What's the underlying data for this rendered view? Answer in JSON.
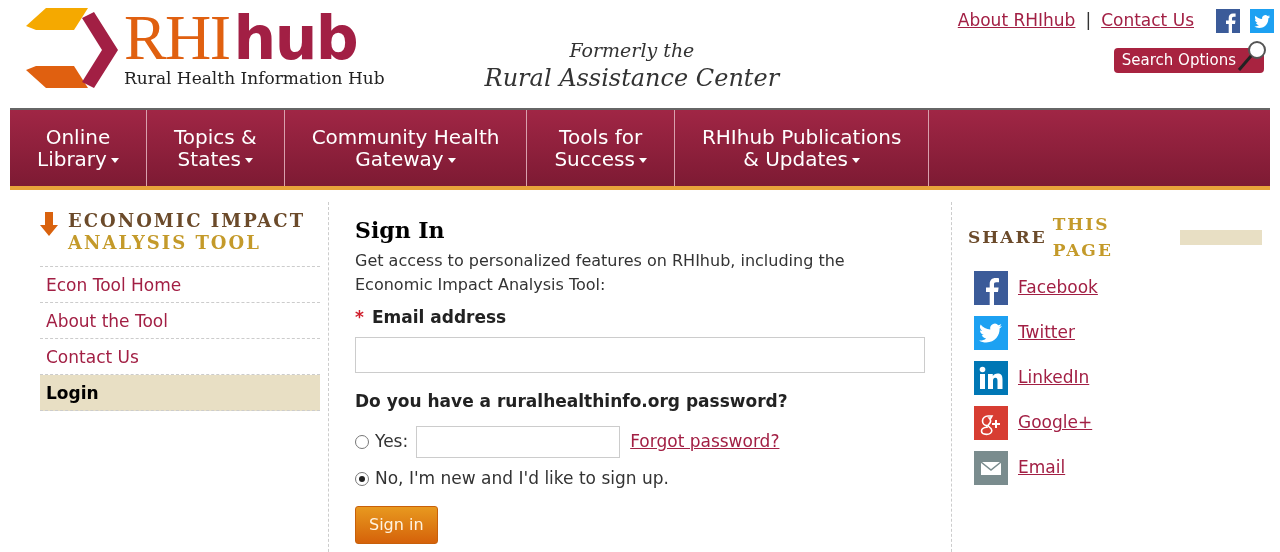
{
  "header": {
    "logo": {
      "brand_main": "RHI",
      "brand_accent": "hub",
      "subtitle": "Rural Health Information Hub"
    },
    "tagline": {
      "line_1": "Formerly the",
      "line_2": "Rural Assistance Center"
    },
    "top_links": [
      "About RHIhub",
      "Contact Us"
    ],
    "separator": "|",
    "search_button": "Search Options"
  },
  "nav": [
    {
      "line_1": "Online",
      "line_2": "Library"
    },
    {
      "line_1": "Topics &",
      "line_2": "States"
    },
    {
      "line_1": "Community Health",
      "line_2": "Gateway"
    },
    {
      "line_1": "Tools for",
      "line_2": "Success"
    },
    {
      "line_1": "RHIhub Publications",
      "line_2": "& Updates"
    }
  ],
  "sidebar": {
    "heading_1": "ECONOMIC IMPACT",
    "heading_2": "ANALYSIS TOOL",
    "items": [
      {
        "label": "Econ Tool Home",
        "selected": false
      },
      {
        "label": "About the Tool",
        "selected": false
      },
      {
        "label": "Contact Us",
        "selected": false
      },
      {
        "label": "Login",
        "selected": true
      }
    ]
  },
  "form": {
    "title": "Sign In",
    "intro": "Get access to personalized features on RHIhub, including the Economic Impact Analysis Tool:",
    "required_mark": "*",
    "email_label": "Email address",
    "question": "Do you have a ruralhealthinfo.org password?",
    "options": [
      {
        "label": "Yes:",
        "selected": false,
        "kind": "password"
      },
      {
        "label": "No, I'm new and I'd like to sign up.",
        "selected": true,
        "kind": "plain"
      }
    ],
    "forgot_link": "Forgot password?",
    "submit": "Sign in"
  },
  "share": {
    "heading_1": "SHARE",
    "heading_2": "THIS PAGE",
    "items": [
      {
        "label": "Facebook",
        "kind": "facebook"
      },
      {
        "label": "Twitter",
        "kind": "twitter"
      },
      {
        "label": "LinkedIn",
        "kind": "linkedin"
      },
      {
        "label": "Google+",
        "kind": "google"
      },
      {
        "label": "Email",
        "kind": "email"
      }
    ]
  }
}
